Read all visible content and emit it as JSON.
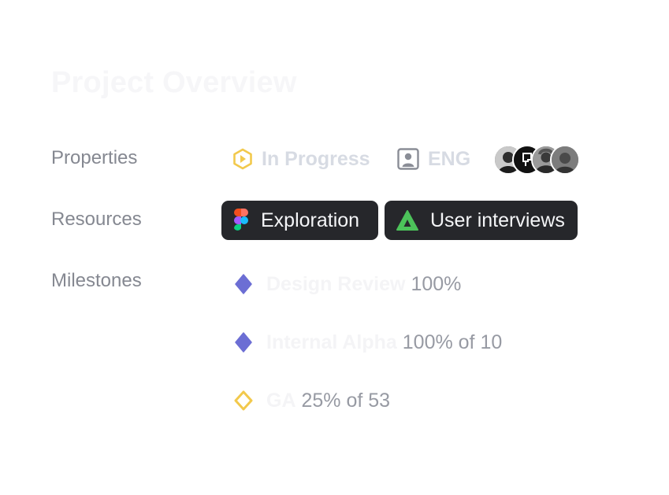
{
  "page": {
    "title": "Project Overview"
  },
  "sections": {
    "properties_label": "Properties",
    "resources_label": "Resources",
    "milestones_label": "Milestones"
  },
  "properties": {
    "status": {
      "label": "In Progress",
      "icon": "in-progress-hexagon-icon",
      "color": "#f2c94c"
    },
    "team": {
      "label": "ENG",
      "icon": "team-icon"
    },
    "members": {
      "icon": "avatar-photos",
      "count_visible": 4
    }
  },
  "resources": [
    {
      "label": "Exploration",
      "icon": "figma-icon"
    },
    {
      "label": "User interviews",
      "icon": "green-triangle-icon",
      "color": "#4cc35a"
    }
  ],
  "milestones": [
    {
      "name": "Design Review",
      "progress": "100%",
      "icon": "diamond-filled-icon",
      "color": "#6c6ed4"
    },
    {
      "name": "Internal Alpha",
      "progress": "100% of 10",
      "icon": "diamond-filled-icon",
      "color": "#6c6ed4"
    },
    {
      "name": "GA",
      "progress": "25% of 53",
      "icon": "diamond-outline-icon",
      "color": "#f2c94c"
    }
  ]
}
